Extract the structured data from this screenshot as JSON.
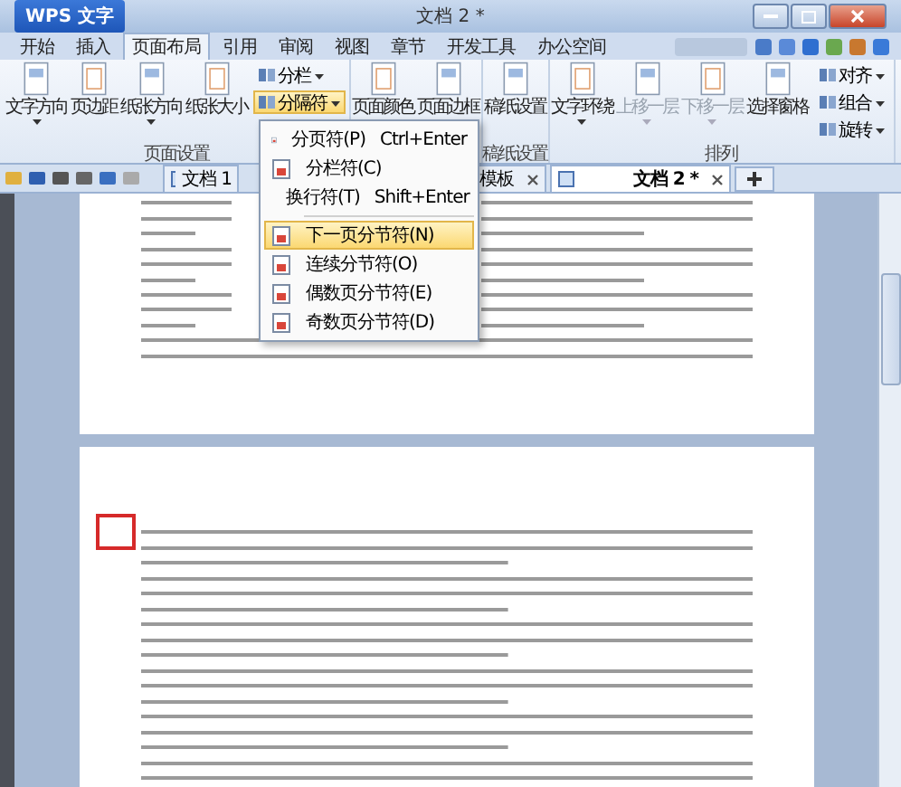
{
  "window": {
    "title": "文档 2 *",
    "app_button": "WPS 文字"
  },
  "tabs": [
    {
      "label": "开始",
      "selected": false
    },
    {
      "label": "插入",
      "selected": false
    },
    {
      "label": "页面布局",
      "selected": true
    },
    {
      "label": "引用",
      "selected": false
    },
    {
      "label": "审阅",
      "selected": false
    },
    {
      "label": "视图",
      "selected": false
    },
    {
      "label": "章节",
      "selected": false
    },
    {
      "label": "开发工具",
      "selected": false
    },
    {
      "label": "办公空间",
      "selected": false
    }
  ],
  "ribbon": [
    {
      "label": "页面设置",
      "items": [
        {
          "kind": "large",
          "label": "文字方向",
          "dropdown": true,
          "disabled": false
        },
        {
          "kind": "large",
          "label": "页边距",
          "dropdown": false,
          "disabled": false
        },
        {
          "kind": "large",
          "label": "纸张方向",
          "dropdown": true,
          "disabled": false
        },
        {
          "kind": "large",
          "label": "纸张大小",
          "dropdown": false,
          "disabled": false
        },
        {
          "kind": "stack",
          "items": [
            {
              "label": "分栏",
              "selected": false
            },
            {
              "label": "分隔符",
              "selected": true
            }
          ]
        }
      ]
    },
    {
      "items": [
        {
          "kind": "large",
          "label": "页面颜色",
          "dropdown": false,
          "disabled": false
        },
        {
          "kind": "large",
          "label": "页面边框",
          "dropdown": false,
          "disabled": false
        }
      ]
    },
    {
      "label": "稿纸设置",
      "items": [
        {
          "kind": "large",
          "label": "稿纸设置",
          "dropdown": false,
          "disabled": false
        }
      ]
    },
    {
      "label": "排列",
      "items": [
        {
          "kind": "large",
          "label": "文字环绕",
          "dropdown": true,
          "disabled": false
        },
        {
          "kind": "large",
          "label": "上移一层",
          "dropdown": true,
          "disabled": true
        },
        {
          "kind": "large",
          "label": "下移一层",
          "dropdown": true,
          "disabled": true
        },
        {
          "kind": "large",
          "label": "选择窗格",
          "dropdown": false,
          "disabled": false
        },
        {
          "kind": "stack",
          "items": [
            {
              "label": "对齐",
              "selected": false
            },
            {
              "label": "组合",
              "selected": false
            },
            {
              "label": "旋转",
              "selected": false
            }
          ]
        }
      ]
    }
  ],
  "doc_tabs": [
    {
      "label": "文档 1",
      "selected": false,
      "close_button": false
    },
    {
      "label": "模板",
      "selected": false,
      "close_button": true
    },
    {
      "label": "文档 2 *",
      "selected": true,
      "close_button": true
    }
  ],
  "menu": [
    {
      "label": "分页符(P)",
      "shortcut": "Ctrl+Enter",
      "selected": false
    },
    {
      "label": "分栏符(C)",
      "selected": false
    },
    {
      "label": "换行符(T)",
      "shortcut": "Shift+Enter",
      "selected": false
    },
    {
      "kind": "separator"
    },
    {
      "label": "下一页分节符(N)",
      "selected": true
    },
    {
      "label": "连续分节符(O)",
      "selected": false
    },
    {
      "label": "偶数页分节符(E)",
      "selected": false
    },
    {
      "label": "奇数页分节符(D)",
      "selected": false
    }
  ]
}
